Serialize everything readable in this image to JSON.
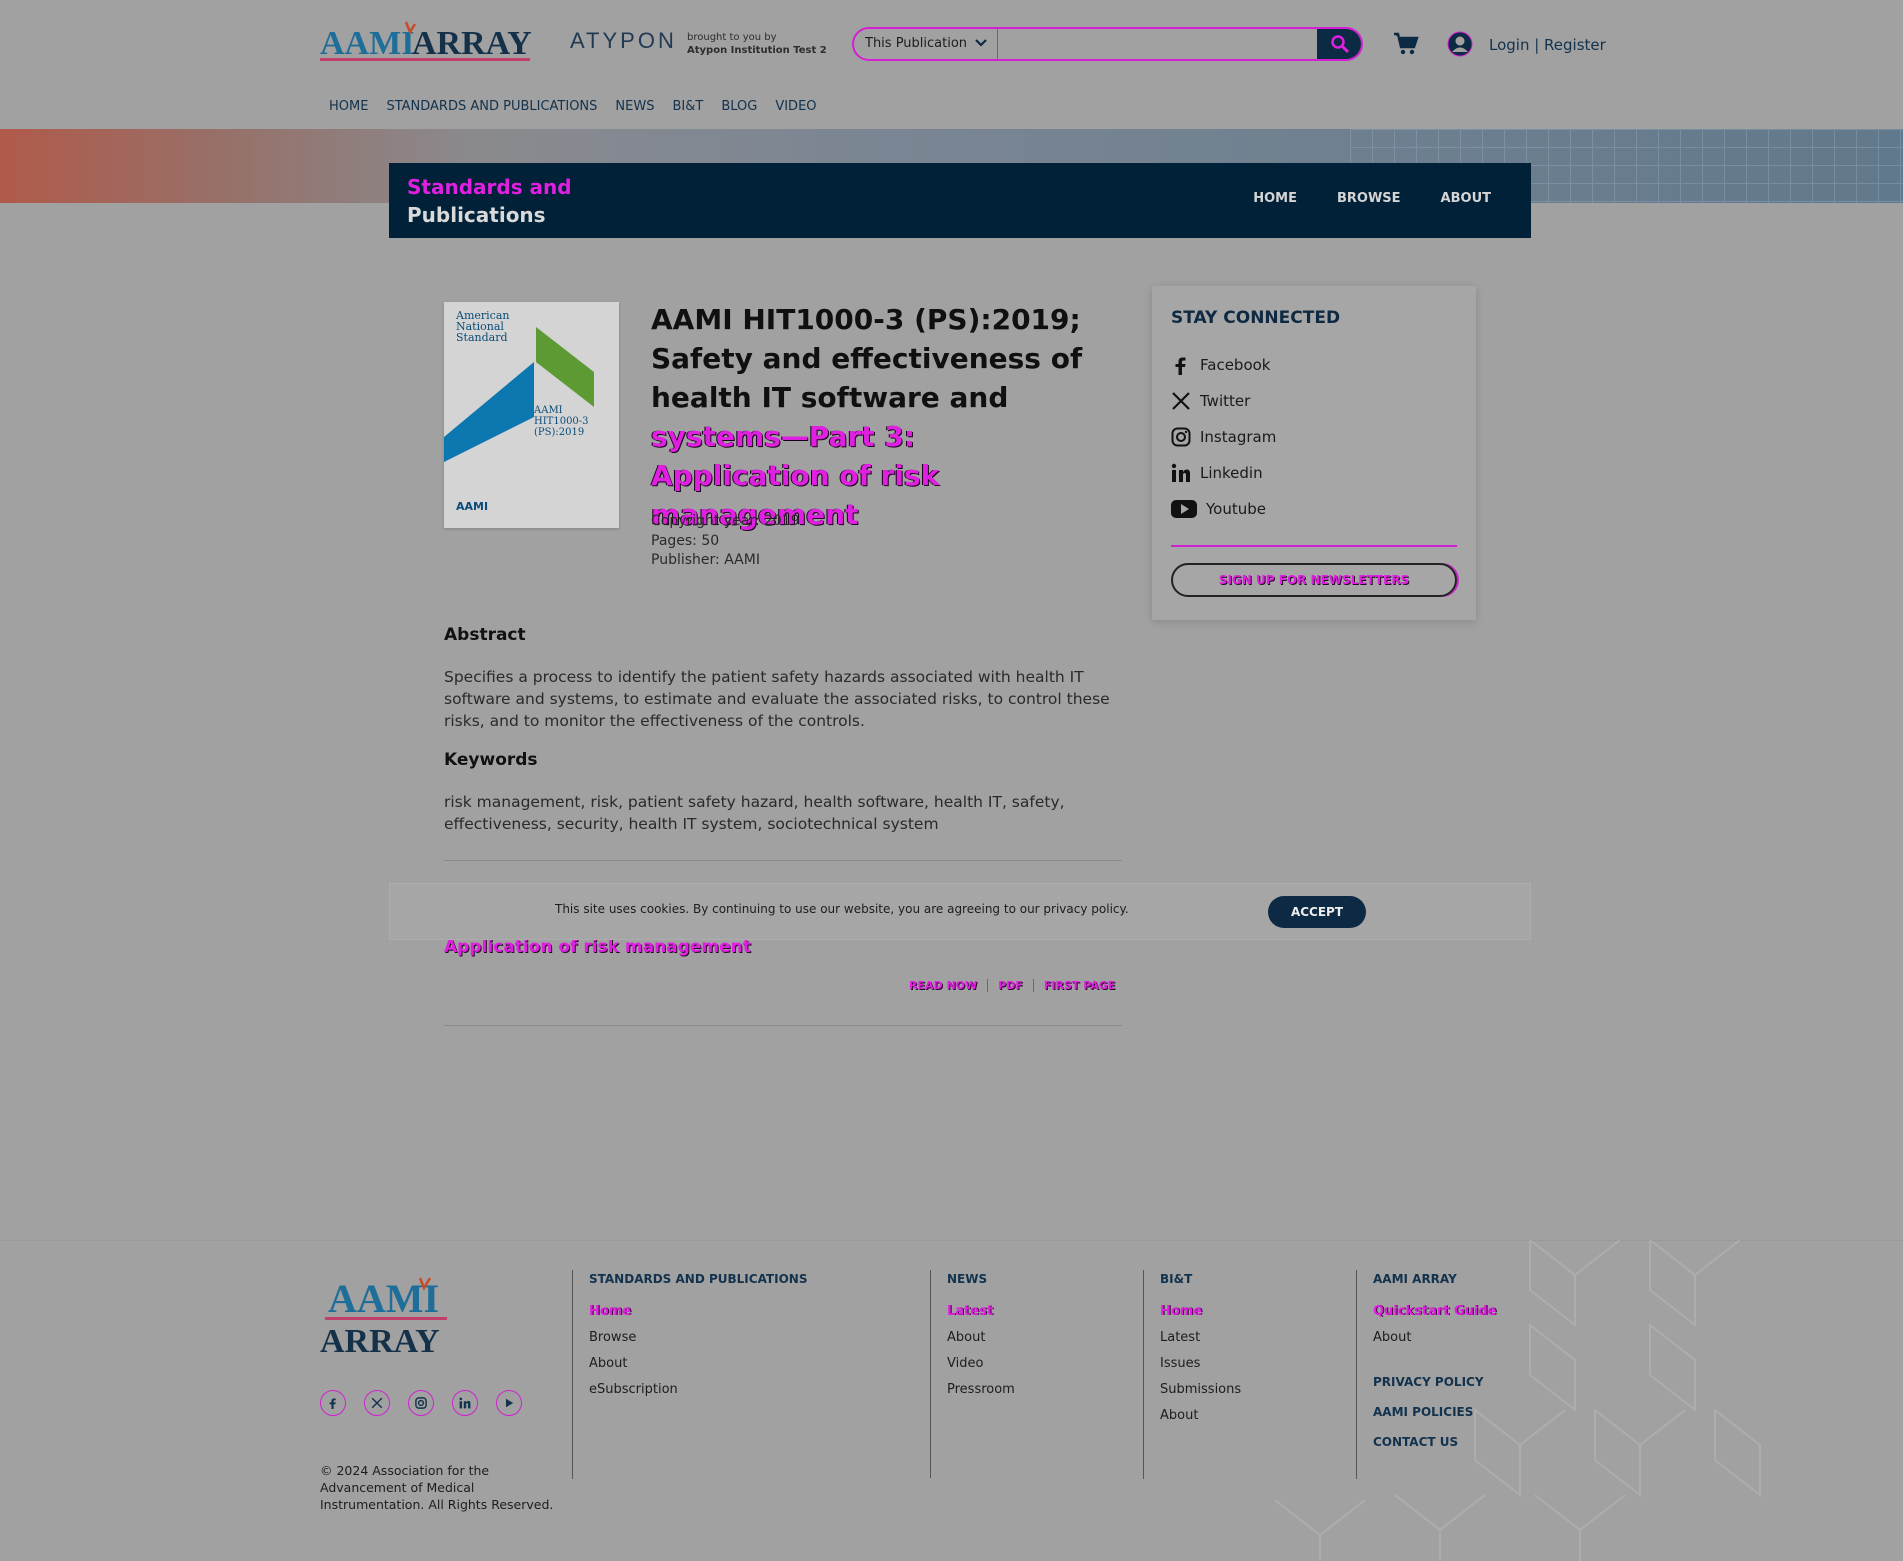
{
  "header": {
    "logo_text": "AAMI ARRAY",
    "atypon": "ATYPON",
    "brought_by": "brought to you by",
    "institution": "Atypon Institution Test 2",
    "search_scope": "This Publication",
    "search_placeholder": "",
    "login": "Login | Register",
    "nav": [
      "HOME",
      "STANDARDS AND PUBLICATIONS",
      "NEWS",
      "BI&T",
      "BLOG",
      "VIDEO"
    ]
  },
  "subnav": {
    "title_line1": "Standards and",
    "title_line2": "Publications",
    "links": [
      "HOME",
      "BROWSE",
      "ABOUT"
    ]
  },
  "book": {
    "cover_lines": [
      "American",
      "National",
      "Standard"
    ],
    "cover_code": [
      "AAMI",
      "HIT1000-3",
      "(PS):2019"
    ],
    "cover_publisher": "AAMI",
    "title_plain": "AAMI HIT1000-3 (PS):2019; Safety and effectiveness of health IT software and",
    "title_highlight": "systems—Part 3: Application of risk management",
    "copyright": "Copyright year: 2019",
    "pages": "Pages: 50",
    "publisher": "Publisher: AAMI"
  },
  "abstract": {
    "heading": "Abstract",
    "text": "Specifies a process to identify the patient safety hazards associated with health IT software and systems, to estimate and evaluate the associated risks, to control these risks, and to monitor the effectiveness of the controls."
  },
  "keywords": {
    "heading": "Keywords",
    "text": "risk management, risk, patient safety hazard, health software, health IT, safety, effectiveness, security, health IT system, sociotechnical system"
  },
  "cookie": {
    "text": "This site uses cookies. By continuing to use our website, you are agreeing to our privacy policy.",
    "accept": "ACCEPT"
  },
  "content_item": {
    "title": "Application of risk management",
    "links": [
      "READ NOW",
      "PDF",
      "FIRST PAGE"
    ]
  },
  "stay_connected": {
    "heading": "STAY CONNECTED",
    "items": [
      "Facebook",
      "Twitter",
      "Instagram",
      "Linkedin",
      "Youtube"
    ],
    "newsletter": "SIGN UP FOR NEWSLETTERS"
  },
  "footer": {
    "logo_top": "AAMI",
    "logo_bottom": "ARRAY",
    "copyright": "© 2024 Association for the Advancement of Medical Instrumentation. All Rights Reserved.",
    "col1": {
      "heading": "STANDARDS AND PUBLICATIONS",
      "items": [
        "Home",
        "Browse",
        "About",
        "eSubscription"
      ]
    },
    "col2": {
      "heading": "NEWS",
      "items": [
        "Latest",
        "About",
        "Video",
        "Pressroom"
      ]
    },
    "col3": {
      "heading": "BI&T",
      "items": [
        "Home",
        "Latest",
        "Issues",
        "Submissions",
        "About"
      ]
    },
    "col4": {
      "heading": "AAMI ARRAY",
      "items": [
        "Quickstart Guide",
        "About"
      ],
      "bold_links": [
        "PRIVACY POLICY",
        "AAMI POLICIES",
        "CONTACT US"
      ]
    }
  },
  "colors": {
    "navy": "#002137",
    "accent": "#e020e0",
    "background": "#a1a1a1"
  }
}
